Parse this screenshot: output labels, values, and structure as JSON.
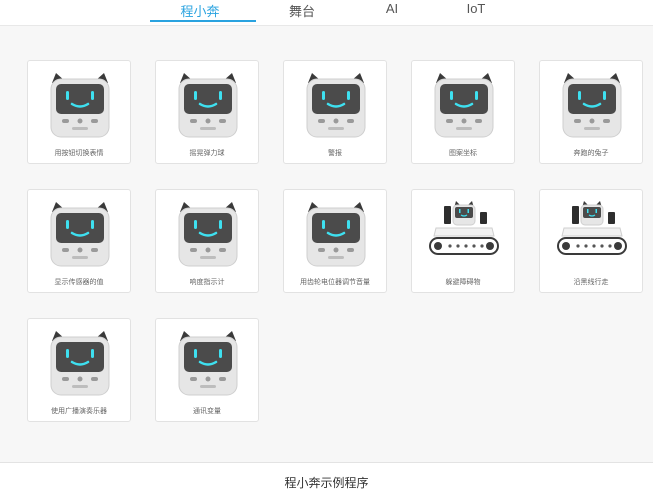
{
  "tabs": [
    {
      "label": "程小奔",
      "active": true
    },
    {
      "label": "舞台",
      "active": false
    },
    {
      "label": "AI",
      "active": false
    },
    {
      "label": "IoT",
      "active": false
    }
  ],
  "accent_color": "#2aa3e0",
  "examples": [
    {
      "label": "用按钮切换表情",
      "image": "robot-face-icon"
    },
    {
      "label": "摇晃弹力球",
      "image": "robot-face-icon"
    },
    {
      "label": "警报",
      "image": "robot-face-icon"
    },
    {
      "label": "图案坐标",
      "image": "robot-face-icon"
    },
    {
      "label": "奔跑的兔子",
      "image": "robot-face-icon"
    },
    {
      "label": "显示传感器的值",
      "image": "robot-face-icon"
    },
    {
      "label": "响度指示计",
      "image": "robot-face-icon"
    },
    {
      "label": "用齿轮电位器调节音量",
      "image": "robot-face-icon"
    },
    {
      "label": "躲避障碍物",
      "image": "robot-tank-icon"
    },
    {
      "label": "沿黑线行走",
      "image": "robot-tank-icon"
    },
    {
      "label": "使用广播演奏乐器",
      "image": "robot-face-icon"
    },
    {
      "label": "通讯变量",
      "image": "robot-face-icon"
    }
  ],
  "caption": "程小奔示例程序"
}
